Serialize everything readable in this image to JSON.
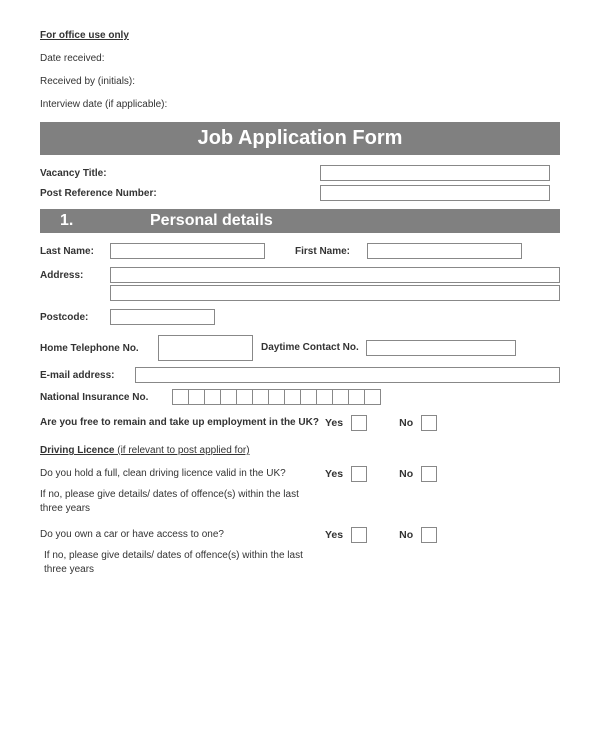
{
  "office": {
    "header": "For office use only",
    "date_received": "Date received:",
    "received_by": "Received by (initials):",
    "interview_date": "Interview date (if applicable):"
  },
  "title": "Job Application Form",
  "vacancy": {
    "title_label": "Vacancy Title:",
    "ref_label": "Post Reference Number:"
  },
  "section1": {
    "num": "1.",
    "title": "Personal details"
  },
  "personal": {
    "last_name": "Last Name:",
    "first_name": "First Name:",
    "address": "Address:",
    "postcode": "Postcode:",
    "home_tel": "Home Telephone No.",
    "daytime": "Daytime Contact No.",
    "email": "E-mail address:",
    "nino": "National Insurance No."
  },
  "q_uk": {
    "text": "Are you free to remain and take up employment in the UK?",
    "yes": "Yes",
    "no": "No"
  },
  "driving": {
    "header": "Driving Licence",
    "note": " (if relevant to post applied for)",
    "q_full": "Do you hold a full, clean driving licence valid in the UK?",
    "detail1": "If no, please give details/ dates of offence(s) within the last three years",
    "q_car": "Do you own a car or have access to one?",
    "detail2": "If no, please give details/ dates of offence(s) within the last three years",
    "yes": "Yes",
    "no": "No"
  }
}
